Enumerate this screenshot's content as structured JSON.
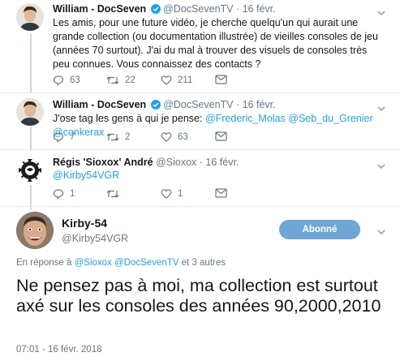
{
  "tweets": [
    {
      "name": "William - DocSeven",
      "handle": "@DocSevenTV",
      "date": "· 16 févr.",
      "text": "Les amis, pour une future vidéo, je cherche quelqu'un qui aurait une grande collection (ou documentation illustrée) de vieilles consoles de jeu (années 70 surtout). J'ai du mal à trouver des visuels de consoles très peu connues. Vous connaissez des contacts ?",
      "replies": "63",
      "retweets": "22",
      "likes": "211"
    },
    {
      "name": "William - DocSeven",
      "handle": "@DocSevenTV",
      "date": "· 16 févr.",
      "text_prefix": "J'ose tag les gens à qui je pense: ",
      "mentions": [
        "@Frederic_Molas",
        "@Seb_du_Grenier",
        "@conkerax"
      ],
      "replies": "7",
      "retweets": "2",
      "likes": "63"
    },
    {
      "name": "Régis 'Sioxox' André",
      "handle": "@Sioxox",
      "date": "· 16 févr.",
      "mention": "@Kirby54VGR",
      "replies": "1",
      "retweets": "",
      "likes": "1"
    }
  ],
  "focused": {
    "name": "Kirby-54",
    "handle": "@Kirby54VGR",
    "follow_label": "Abonné",
    "reply_prefix": "En réponse à ",
    "reply_mentions": [
      "@Sioxox",
      "@DocSevenTV"
    ],
    "reply_suffix": " et 3 autres",
    "text": "Ne pensez pas à moi, ma collection est surtout axé sur les consoles des années 90,2000,2010",
    "timestamp": "07:01 - 16 févr. 2018"
  },
  "colors": {
    "link": "#1da1f2",
    "muted": "#657786",
    "follow_button": "#6ea6d6",
    "separator": "#e6ecf0"
  }
}
